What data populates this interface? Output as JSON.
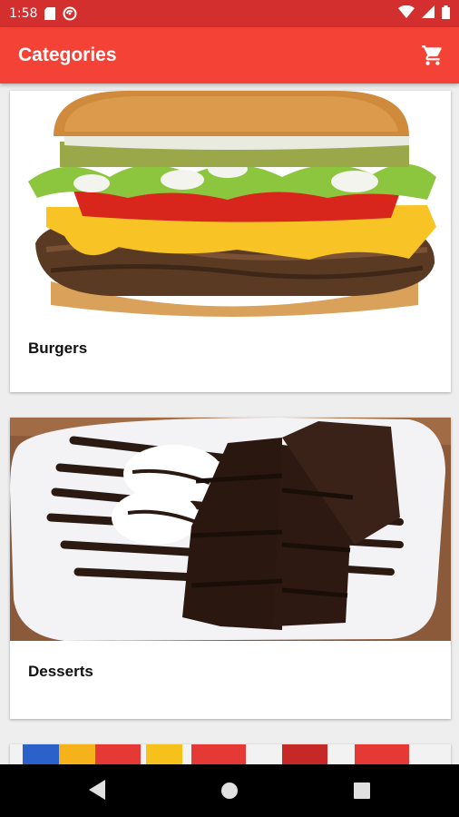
{
  "status_bar": {
    "time": "1:58",
    "icons": [
      "sd-card-icon",
      "sync-icon",
      "wifi-icon",
      "signal-icon",
      "battery-icon"
    ]
  },
  "app_bar": {
    "title": "Categories",
    "cart_icon": "shopping-cart-icon"
  },
  "categories": [
    {
      "label": "Burgers",
      "image": "burger-photo"
    },
    {
      "label": "Desserts",
      "image": "chocolate-cake-photo"
    },
    {
      "label": "",
      "image": "drinks-photo"
    }
  ],
  "nav_bar": {
    "icons": [
      "back-icon",
      "home-icon",
      "recents-icon"
    ]
  },
  "colors": {
    "status_bar": "#d32f2f",
    "app_bar": "#f44336",
    "background": "#eeeeee",
    "nav_bar": "#000000"
  }
}
